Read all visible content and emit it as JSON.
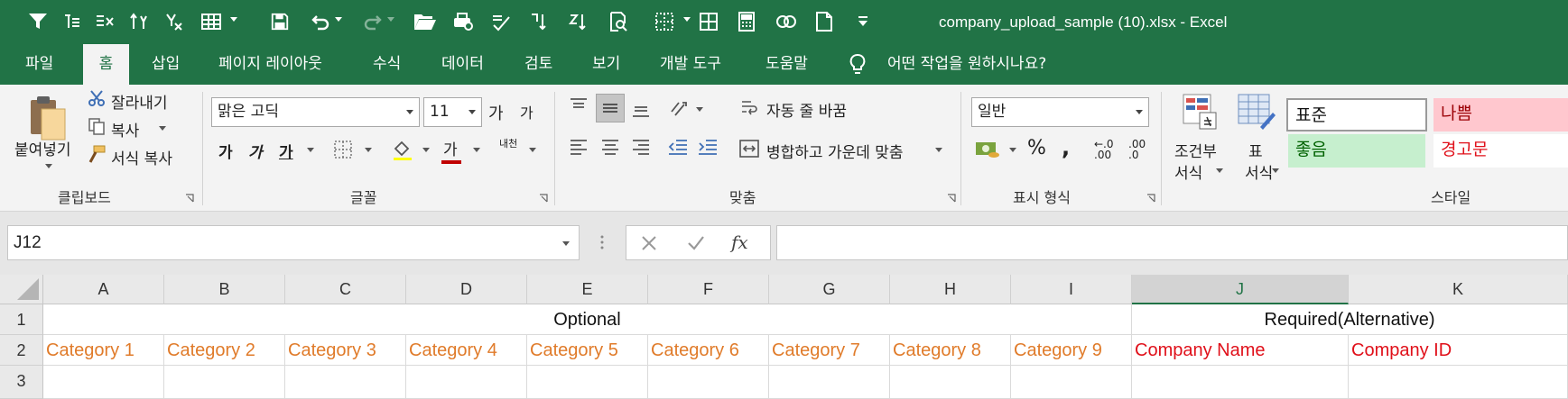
{
  "window": {
    "title": "company_upload_sample (10).xlsx  -  Excel"
  },
  "quick_access": [
    "filter-icon",
    "indent-icon",
    "clear-filter-icon",
    "sort-icon",
    "remove-filter-icon",
    "table-icon",
    "save-icon",
    "undo-icon",
    "redo-icon",
    "open-icon",
    "print-preview-icon",
    "check-icon",
    "sort-az-icon",
    "sort-za-icon",
    "find-icon",
    "borders-icon",
    "grid-icon",
    "calculator-icon",
    "link-icon",
    "new-doc-icon",
    "customize-icon"
  ],
  "tabs": [
    {
      "label": "파일"
    },
    {
      "label": "홈"
    },
    {
      "label": "삽입"
    },
    {
      "label": "페이지 레이아웃"
    },
    {
      "label": "수식"
    },
    {
      "label": "데이터"
    },
    {
      "label": "검토"
    },
    {
      "label": "보기"
    },
    {
      "label": "개발 도구"
    },
    {
      "label": "도움말"
    }
  ],
  "tell_me": "어떤 작업을 원하시나요?",
  "ribbon": {
    "clipboard": {
      "paste": "붙여넣기",
      "cut": "잘라내기",
      "copy": "복사",
      "format_painter": "서식 복사",
      "label": "클립보드"
    },
    "font": {
      "name": "맑은 고딕",
      "size": "11",
      "grow": "가",
      "shrink": "가",
      "bold": "가",
      "italic": "가",
      "underline": "가",
      "font_color": "가",
      "phonetic": "내천",
      "label": "글꼴"
    },
    "alignment": {
      "wrap": "자동 줄 바꿈",
      "merge": "병합하고 가운데 맞춤",
      "label": "맞춤"
    },
    "number": {
      "format": "일반",
      "percent": "%",
      "comma": ",",
      "inc_decimal": ".00",
      "dec_decimal": ".0",
      "label": "표시 형식"
    },
    "styles": {
      "conditional": "조건부",
      "conditional2": "서식",
      "table": "표",
      "table2": "서식",
      "normal": "표준",
      "bad": "나쁨",
      "good": "좋음",
      "warning": "경고문",
      "label": "스타일"
    }
  },
  "formula_bar": {
    "name_box": "J12",
    "fx": "fx",
    "formula": ""
  },
  "sheet": {
    "columns": [
      "A",
      "B",
      "C",
      "D",
      "E",
      "F",
      "G",
      "H",
      "I",
      "J",
      "K"
    ],
    "rows": [
      "1",
      "2",
      "3"
    ],
    "row1": {
      "optional": "Optional",
      "required": "Required(Alternative)"
    },
    "row2": [
      "Category 1",
      "Category 2",
      "Category 3",
      "Category 4",
      "Category 5",
      "Category 6",
      "Category 7",
      "Category 8",
      "Category 9",
      "Company Name",
      "Company ID"
    ],
    "colors": {
      "optional": "#e07b2a",
      "required": "#e0101a"
    }
  },
  "colors": {
    "brand": "#217346",
    "ribbon_bg": "#f3f3f3"
  }
}
